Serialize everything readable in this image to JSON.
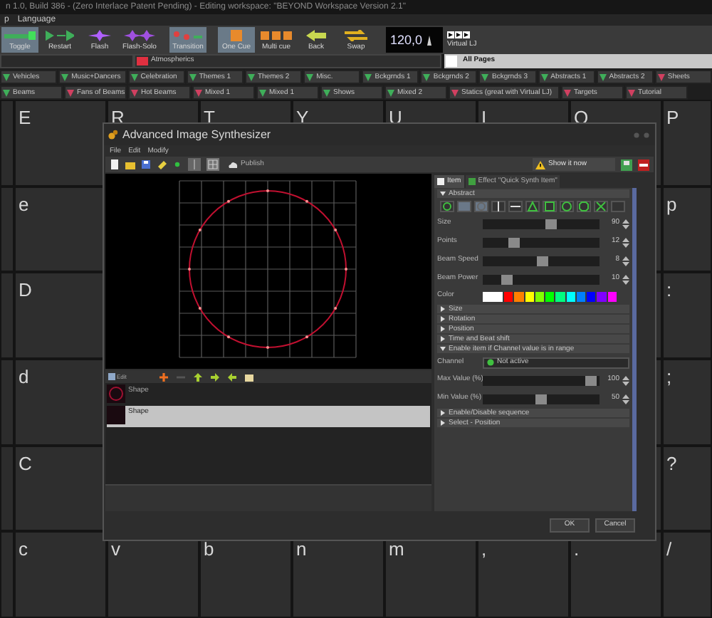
{
  "title_bar": {
    "title": "n 1.0, Build 386 - (Zero Interlace Patent Pending) - Editing workspace: \"BEYOND Workspace Version 2.1\""
  },
  "menu": [
    "p",
    "Language"
  ],
  "toolbar": {
    "buttons": [
      {
        "label": "Toggle",
        "selected": true
      },
      {
        "label": "Restart",
        "selected": false
      },
      {
        "label": "Flash",
        "selected": false
      },
      {
        "label": "Flash-Solo",
        "selected": false
      },
      {
        "label": "Transition",
        "selected": true
      },
      {
        "label": "One Cue",
        "selected": true
      },
      {
        "label": "Multi cue",
        "selected": false
      },
      {
        "label": "Back",
        "selected": false
      },
      {
        "label": "Swap",
        "selected": false
      }
    ],
    "bpm": "120,0",
    "virtual_lj": "Virtual LJ"
  },
  "page_bar": {
    "current_page": "Atmospherics",
    "all_pages": "All Pages"
  },
  "page_tabs": [
    [
      {
        "label": "Vehicles",
        "color": "#3fae5a"
      },
      {
        "label": "Music+Dancers",
        "color": "#3fae5a"
      },
      {
        "label": "Celebration",
        "color": "#3fae5a"
      },
      {
        "label": "Themes 1",
        "color": "#3fae5a"
      },
      {
        "label": "Themes 2",
        "color": "#3fae5a"
      },
      {
        "label": "Misc.",
        "color": "#3fae5a"
      },
      {
        "label": "Bckgrnds 1",
        "color": "#3fae5a"
      },
      {
        "label": "Bckgrnds 2",
        "color": "#3fae5a"
      },
      {
        "label": "Bckgrnds 3",
        "color": "#3fae5a"
      },
      {
        "label": "Abstracts 1",
        "color": "#3fae5a"
      },
      {
        "label": "Abstracts 2",
        "color": "#3fae5a"
      },
      {
        "label": "Sheets",
        "color": "#d04060"
      }
    ],
    [
      {
        "label": "Beams",
        "color": "#3fae5a"
      },
      {
        "label": "Fans of Beams",
        "color": "#d04060"
      },
      {
        "label": "Hot Beams",
        "color": "#d04060"
      },
      {
        "label": "Mixed 1",
        "color": "#d04060"
      },
      {
        "label": "Mixed 1",
        "color": "#3fae5a"
      },
      {
        "label": "Shows",
        "color": "#3fae5a"
      },
      {
        "label": "Mixed 2",
        "color": "#3fae5a"
      },
      {
        "label": "Statics (great with Virtual LJ)",
        "color": "#d04060"
      },
      {
        "label": "Targets",
        "color": "#d04060"
      },
      {
        "label": "Tutorial",
        "color": "#d04060"
      }
    ]
  ],
  "cue_grid": [
    {
      "keys": [
        "E",
        "R",
        "T",
        "Y",
        "U",
        "I",
        "O",
        "P"
      ]
    },
    {
      "first_key": "e",
      "last_key": "p"
    },
    {
      "first_key": "D",
      "last_key": ":"
    },
    {
      "first_key": "d",
      "last_key": ";"
    },
    {
      "first_key": "C",
      "last_key": "?"
    },
    {
      "keys": [
        "c",
        "v",
        "b",
        "n",
        "m",
        ",",
        ".",
        "/"
      ]
    }
  ],
  "dialog": {
    "title": "Advanced Image Synthesizer",
    "menu": [
      "File",
      "Edit",
      "Modify"
    ],
    "publish": "Publish",
    "show_it_now": "Show it now",
    "items_toolbar": {
      "edit": "Edit"
    },
    "items": [
      {
        "label": "Shape",
        "selected": false
      },
      {
        "label": "Shape",
        "selected": true
      }
    ],
    "tabs": [
      {
        "label": "Item",
        "selected": true
      },
      {
        "label": "Effect \"Quick Synth Item\"",
        "selected": false
      }
    ],
    "sections": [
      {
        "kind": "abstract",
        "title": "Abstract",
        "expanded": true,
        "shape_buttons": [
          {
            "selected": false
          },
          {
            "selected": true
          },
          {
            "selected": true
          },
          {
            "selected": false
          },
          {
            "selected": false
          },
          {
            "selected": false
          },
          {
            "selected": false
          },
          {
            "selected": false
          },
          {
            "selected": false
          },
          {
            "selected": false
          },
          {
            "selected": false
          }
        ],
        "sliders": [
          {
            "label": "Size",
            "value": "90",
            "level": 0.6
          },
          {
            "label": "Points",
            "value": "12",
            "level": 0.24
          },
          {
            "label": "Beam Speed",
            "value": "8",
            "level": 0.52
          },
          {
            "label": "Beam Power",
            "value": "10",
            "level": 0.17
          }
        ],
        "color_label": "Color",
        "colors": [
          {
            "color": "#ffffff"
          },
          {
            "color": "#ff0000"
          },
          {
            "color": "#ff8000"
          },
          {
            "color": "#ffff00"
          },
          {
            "color": "#80ff00"
          },
          {
            "color": "#00ff00"
          },
          {
            "color": "#00ff80"
          },
          {
            "color": "#00ffff"
          },
          {
            "color": "#0080ff"
          },
          {
            "color": "#0000ff"
          },
          {
            "color": "#8000ff"
          },
          {
            "color": "#ff00ff"
          }
        ]
      },
      {
        "kind": "header",
        "title": "Size",
        "expanded": false
      },
      {
        "kind": "header",
        "title": "Rotation",
        "expanded": false
      },
      {
        "kind": "header",
        "title": "Position",
        "expanded": false
      },
      {
        "kind": "header",
        "title": "Time and Beat shift",
        "expanded": false
      },
      {
        "kind": "channel",
        "title": "Enable item if Channel value is in range",
        "expanded": true,
        "channel_label": "Channel",
        "channel_value": "Not active",
        "sliders": [
          {
            "label": "Max Value (%)",
            "value": "100",
            "level": 0.97
          },
          {
            "label": "Min Value (%)",
            "value": "50",
            "level": 0.5
          }
        ]
      },
      {
        "kind": "header",
        "title": "Enable/Disable sequence",
        "expanded": false
      },
      {
        "kind": "header",
        "title": "Select - Position",
        "expanded": false
      }
    ],
    "buttons": [
      "OK",
      "Cancel"
    ]
  }
}
